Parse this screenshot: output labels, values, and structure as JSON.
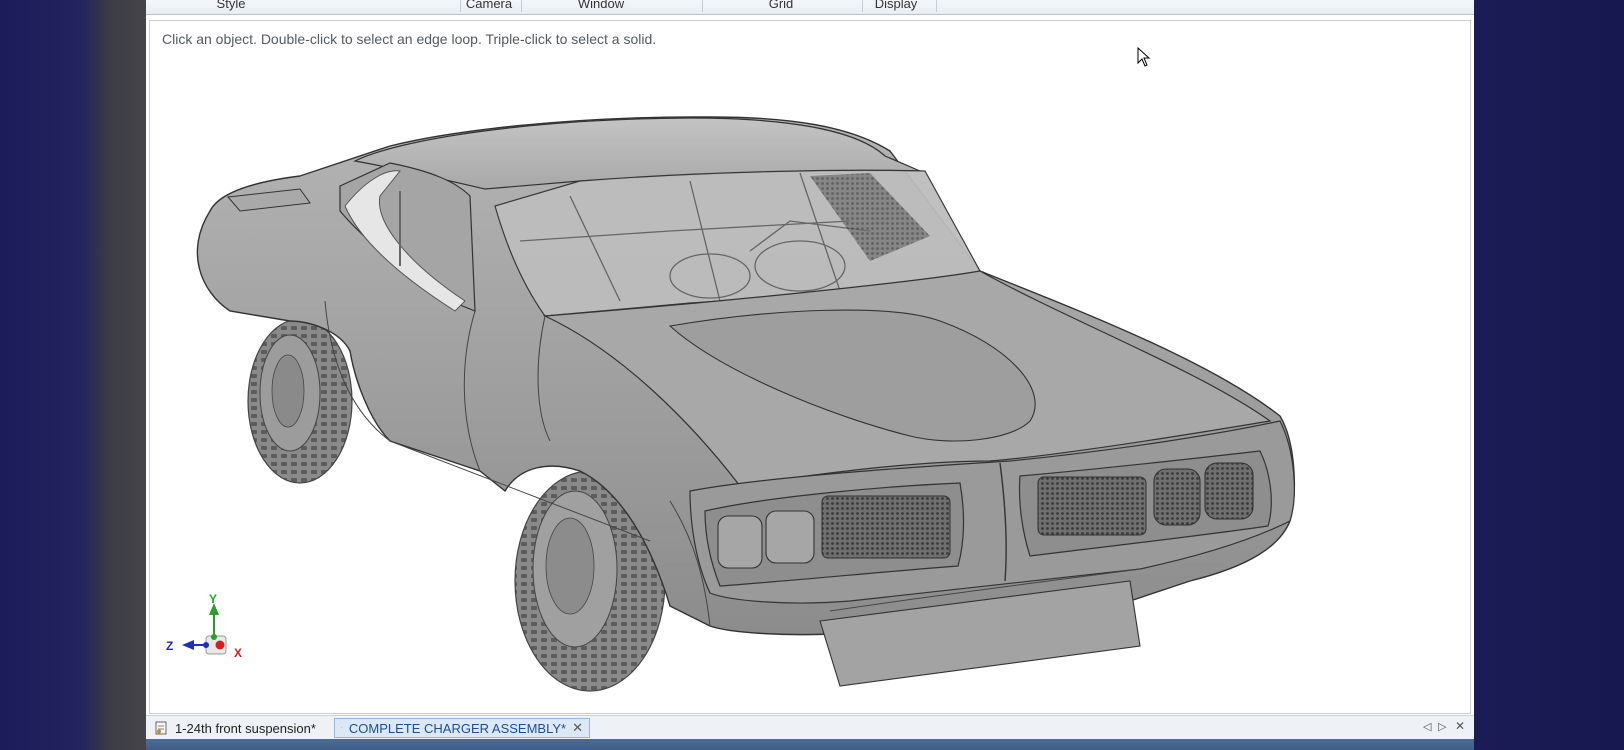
{
  "ribbon": {
    "groups": [
      {
        "label": "Style"
      },
      {
        "label": "Camera"
      },
      {
        "label": "Window"
      },
      {
        "label": "Grid"
      },
      {
        "label": "Display"
      }
    ]
  },
  "viewport": {
    "hint": "Click an object. Double-click to select an edge loop. Triple-click to select a solid."
  },
  "triad": {
    "y_label": "Y",
    "z_label": "Z",
    "x_label": "X"
  },
  "tabs": [
    {
      "label": "1-24th front suspension*",
      "active": false
    },
    {
      "label": "COMPLETE CHARGER ASSEMBLY*",
      "active": true
    }
  ],
  "tab_controls": {
    "prev": "◁",
    "next": "▷",
    "close": "✕"
  },
  "colors": {
    "accent": "#1c4f8e",
    "body_gray": "#9a9a9a",
    "axis_y": "#2aa02a",
    "axis_z": "#1e2fbf",
    "axis_x": "#d02020"
  }
}
